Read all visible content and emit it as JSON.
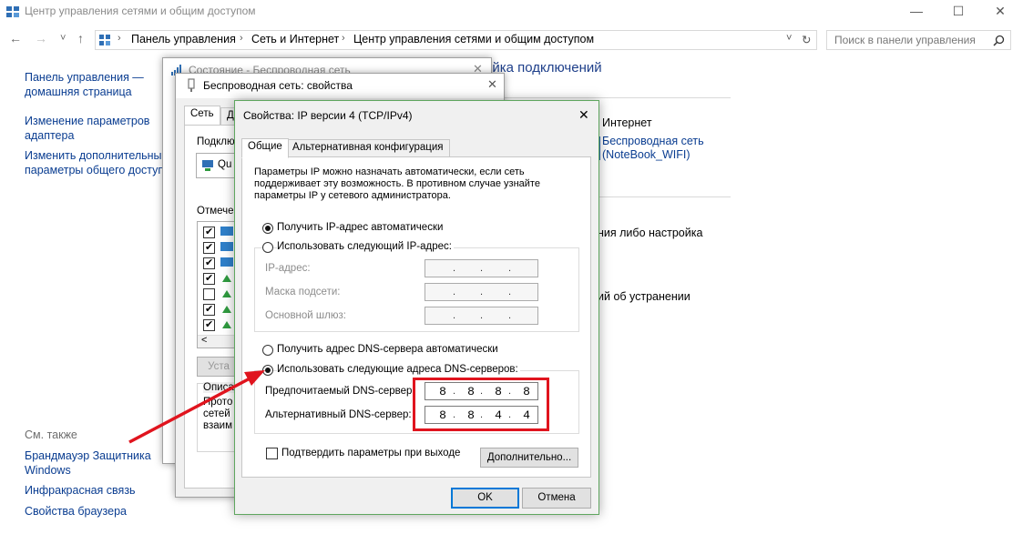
{
  "window": {
    "title": "Центр управления сетями и общим доступом",
    "minimize": "—",
    "maximize": "☐",
    "close": "✕"
  },
  "address_bar": {
    "back": "←",
    "forward": "→",
    "dropdown": "˅",
    "up": "↑",
    "breadcrumbs": [
      "Панель управления",
      "Сеть и Интернет",
      "Центр управления сетями и общим доступом"
    ],
    "separator": "›",
    "refresh": "↻",
    "search_placeholder": "Поиск в панели управления"
  },
  "sidebar": {
    "links": [
      "Панель управления —\nдомашняя страница",
      "Изменение параметров\nадаптера",
      "Изменить дополнительные\nпараметры общего доступа"
    ],
    "see_also_header": "См. также",
    "see_also": [
      "Брандмауэр Защитника\nWindows",
      "Инфракрасная связь",
      "Свойства браузера"
    ]
  },
  "main": {
    "heading_fragment": "ойка подключений",
    "internet_label": "Интернет",
    "wifi_link": "Беспроводная сеть\n(NoteBook_WIFI)",
    "setup_fragment": "ния либо настройка",
    "troubleshoot_fragment": "ий об устранении"
  },
  "status_dialog": {
    "title": "Состояние - Беспроводная сеть"
  },
  "props_dialog": {
    "title": "Беспроводная сеть: свойства",
    "tab_network": "Сеть",
    "tab_second_fragment": "Д",
    "connect_label": "Подклю",
    "adapter_fragment": "Qu",
    "components_label": "Отмечен",
    "install_fragment": "Уста",
    "desc_label": "Описа",
    "desc_text": "Прото\nсетей\nвзаим",
    "scroll_left": "<"
  },
  "ipv4_dialog": {
    "title": "Свойства: IP версии 4 (TCP/IPv4)",
    "close": "✕",
    "tab_general": "Общие",
    "tab_alternate": "Альтернативная конфигурация",
    "intro": "Параметры IP можно назначать автоматически, если сеть\nподдерживает эту возможность. В противном случае узнайте\nпараметры IP у сетевого администратора.",
    "ip_auto": "Получить IP-адрес автоматически",
    "ip_manual": "Использовать следующий IP-адрес:",
    "ip_address_label": "IP-адрес:",
    "subnet_label": "Маска подсети:",
    "gateway_label": "Основной шлюз:",
    "dns_auto": "Получить адрес DNS-сервера автоматически",
    "dns_manual": "Использовать следующие адреса DNS-серверов:",
    "preferred_dns_label": "Предпочитаемый DNS-сервер:",
    "preferred_dns": [
      "8",
      "8",
      "8",
      "8"
    ],
    "alternate_dns_label": "Альтернативный DNS-сервер:",
    "alternate_dns": [
      "8",
      "8",
      "4",
      "4"
    ],
    "validate_label": "Подтвердить параметры при выходе",
    "advanced_button": "Дополнительно...",
    "ok_button": "OK",
    "cancel_button": "Отмена",
    "dot": "."
  },
  "colors": {
    "link": "#0a3d91",
    "dialog_border_green": "#5fa65f",
    "highlight_red": "#e0141e",
    "default_button": "#0078d7"
  }
}
